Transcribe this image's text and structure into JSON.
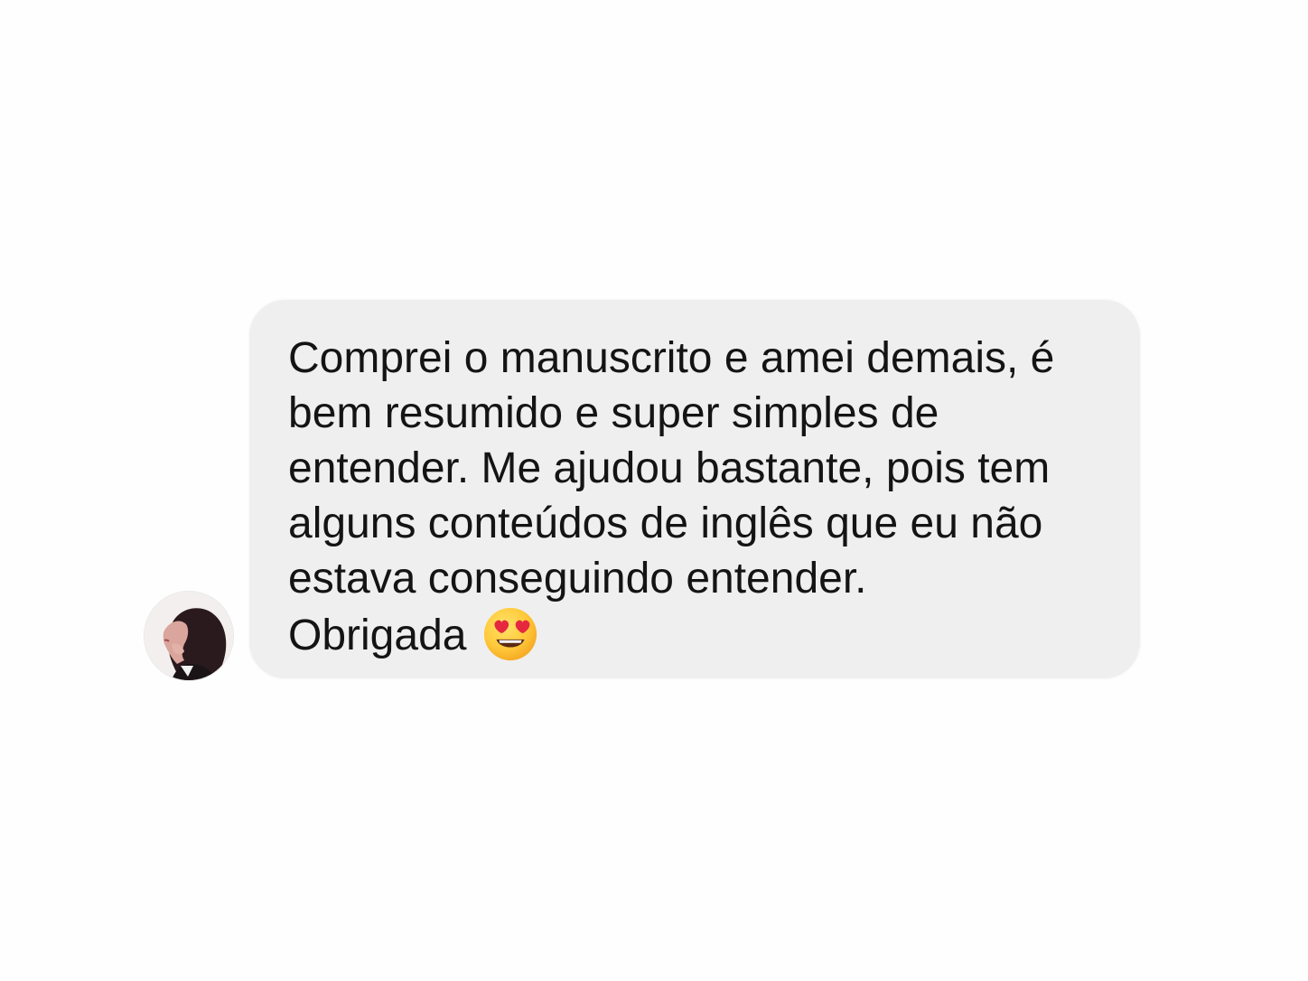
{
  "message": {
    "lines": [
      "Comprei o manuscrito e amei demais, é",
      "bem resumido e super simples de",
      "entender. Me ajudou bastante, pois tem",
      "alguns conteúdos de inglês que eu não",
      "estava conseguindo entender.",
      "Obrigada"
    ],
    "emoji": "smiling-face-with-heart-eyes"
  },
  "colors": {
    "page_background": "#fefefe",
    "bubble_background": "#efefef",
    "text": "#141414"
  }
}
